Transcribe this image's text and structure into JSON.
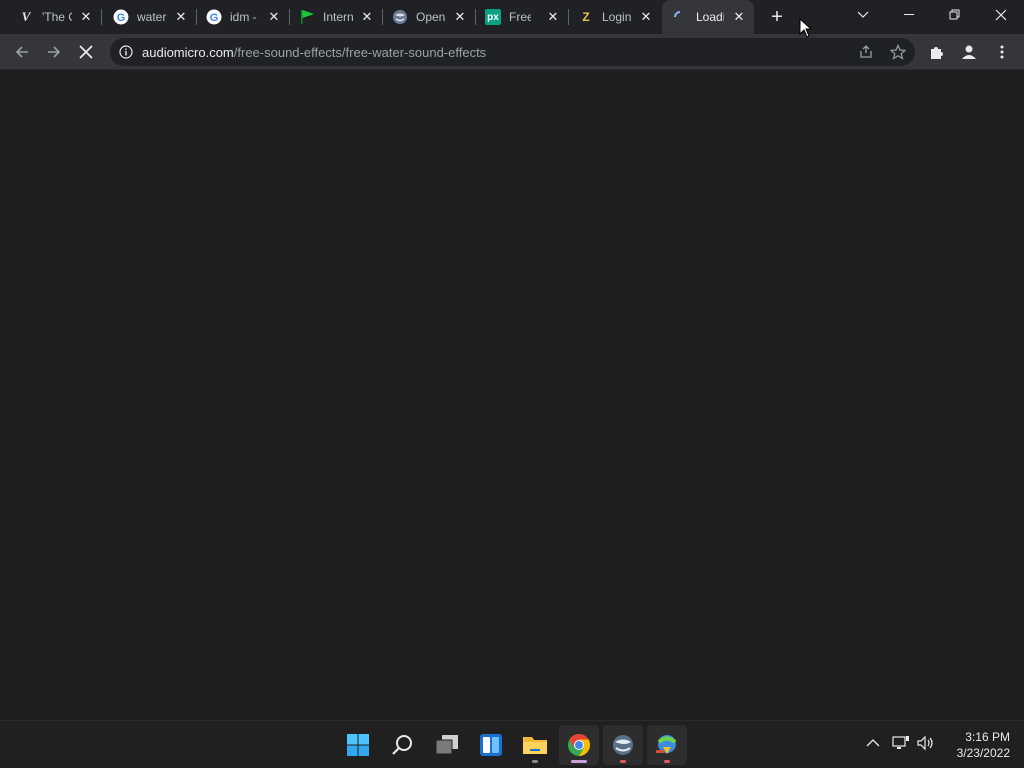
{
  "browser": {
    "tabs": [
      {
        "title": "'The C",
        "icon": "verge-icon",
        "active": false
      },
      {
        "title": "water",
        "icon": "google-icon",
        "active": false
      },
      {
        "title": "idm -",
        "icon": "google-icon",
        "active": false
      },
      {
        "title": "Intern",
        "icon": "green-flag-icon",
        "active": false
      },
      {
        "title": "Open",
        "icon": "globe-icon",
        "active": false
      },
      {
        "title": "Free",
        "icon": "px-icon",
        "active": false
      },
      {
        "title": "Login",
        "icon": "login-icon",
        "active": false
      },
      {
        "title": "Loadi",
        "icon": "loading-spinner-icon",
        "active": true
      }
    ],
    "new_tab_label": "+",
    "favicon_text": {
      "verge": "V",
      "google": "G",
      "px": "px",
      "login": "Z"
    },
    "address": {
      "host": "audiomicro.com",
      "path": "/free-sound-effects/free-water-sound-effects"
    }
  },
  "taskbar": {
    "apps": [
      {
        "name": "start",
        "icon": "windows-start-icon"
      },
      {
        "name": "search",
        "icon": "search-icon"
      },
      {
        "name": "task-view",
        "icon": "task-view-icon"
      },
      {
        "name": "widgets",
        "icon": "widgets-icon"
      },
      {
        "name": "file-explorer",
        "icon": "folder-icon"
      },
      {
        "name": "chrome",
        "icon": "chrome-icon"
      },
      {
        "name": "globe-app",
        "icon": "globe-icon"
      },
      {
        "name": "idm",
        "icon": "download-manager-icon"
      }
    ],
    "time": "3:16 PM",
    "date": "3/23/2022"
  },
  "colors": {
    "accent_blue": "#4cc2ff",
    "chrome_red": "#ea4335",
    "chrome_yellow": "#fbbc04",
    "chrome_green": "#34a853",
    "chrome_blue": "#4285f4"
  }
}
